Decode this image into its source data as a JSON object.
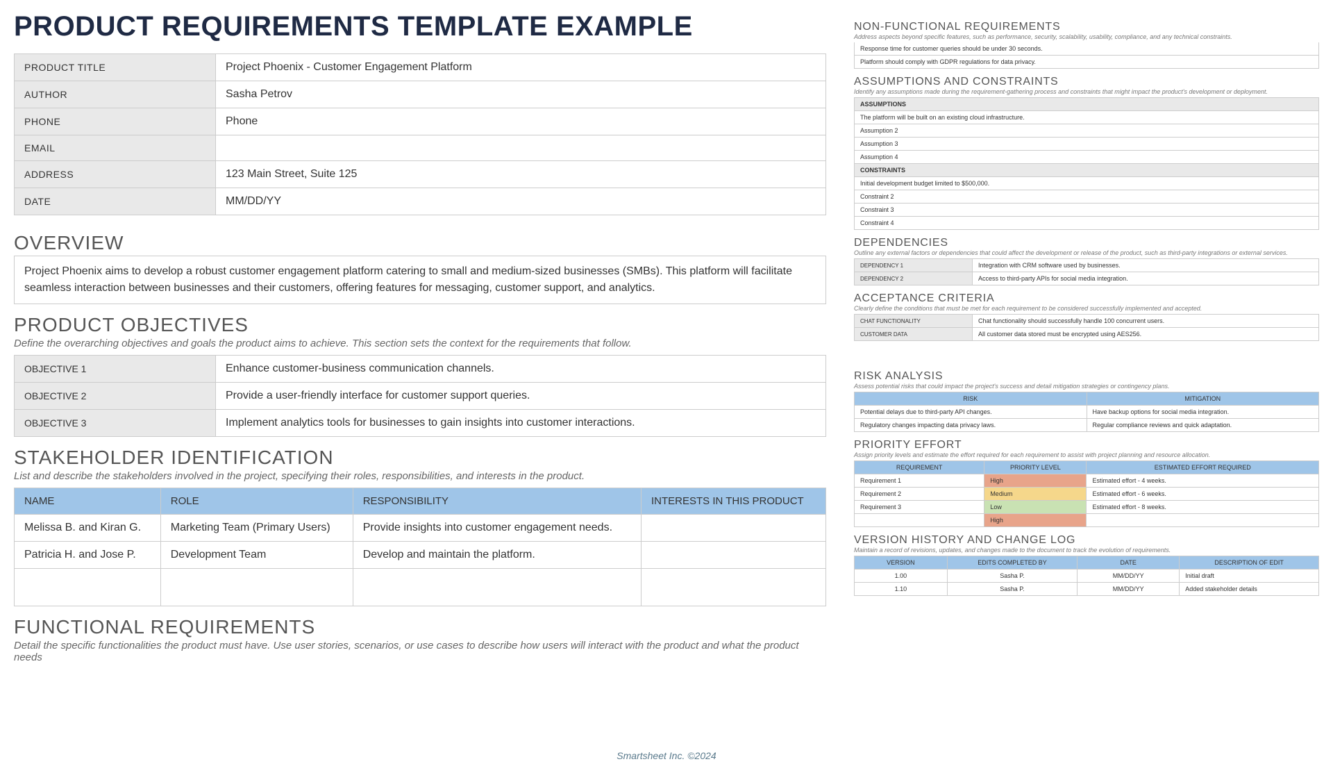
{
  "title": "PRODUCT REQUIREMENTS TEMPLATE EXAMPLE",
  "info": {
    "product_title_label": "PRODUCT TITLE",
    "product_title": "Project Phoenix - Customer Engagement Platform",
    "author_label": "AUTHOR",
    "author": "Sasha Petrov",
    "phone_label": "PHONE",
    "phone": "Phone",
    "email_label": "EMAIL",
    "email": "",
    "address_label": "ADDRESS",
    "address": "123 Main Street, Suite 125",
    "date_label": "DATE",
    "date": "MM/DD/YY"
  },
  "overview": {
    "heading": "OVERVIEW",
    "text": "Project Phoenix aims to develop a robust customer engagement platform catering to small and medium-sized businesses (SMBs). This platform will facilitate seamless interaction between businesses and their customers, offering features for messaging, customer support, and analytics."
  },
  "objectives": {
    "heading": "PRODUCT OBJECTIVES",
    "desc": "Define the overarching objectives and goals the product aims to achieve. This section sets the context for the requirements that follow.",
    "items": [
      {
        "label": "OBJECTIVE 1",
        "text": "Enhance customer-business communication channels."
      },
      {
        "label": "OBJECTIVE 2",
        "text": "Provide a user-friendly interface for customer support queries."
      },
      {
        "label": "OBJECTIVE 3",
        "text": "Implement analytics tools for businesses to gain insights into customer interactions."
      }
    ]
  },
  "stakeholders": {
    "heading": "STAKEHOLDER IDENTIFICATION",
    "desc": "List and describe the stakeholders involved in the project, specifying their roles, responsibilities, and interests in the product.",
    "headers": [
      "NAME",
      "ROLE",
      "RESPONSIBILITY",
      "INTERESTS IN THIS PRODUCT"
    ],
    "rows": [
      {
        "name": "Melissa B. and Kiran G.",
        "role": "Marketing Team (Primary Users)",
        "resp": "Provide insights into customer engagement needs.",
        "interests": ""
      },
      {
        "name": "Patricia H. and Jose P.",
        "role": "Development Team",
        "resp": "Develop and maintain the platform.",
        "interests": ""
      },
      {
        "name": "",
        "role": "",
        "resp": "",
        "interests": ""
      }
    ]
  },
  "functional": {
    "heading": "FUNCTIONAL REQUIREMENTS",
    "desc": "Detail the specific functionalities the product must have. Use user stories, scenarios, or use cases to describe how users will interact with the product and what the product needs"
  },
  "nonfunctional": {
    "heading": "NON-FUNCTIONAL REQUIREMENTS",
    "desc": "Address aspects beyond specific features, such as performance, security, scalability, usability, compliance, and any technical constraints.",
    "items": [
      "Response time for customer queries should be under 30 seconds.",
      "Platform should comply with GDPR regulations for data privacy."
    ]
  },
  "assumptions": {
    "heading": "ASSUMPTIONS AND CONSTRAINTS",
    "desc": "Identify any assumptions made during the requirement-gathering process and constraints that might impact the product's development or deployment.",
    "assumptions_label": "ASSUMPTIONS",
    "assumptions": [
      "The platform will be built on an existing cloud infrastructure.",
      "Assumption 2",
      "Assumption 3",
      "Assumption 4"
    ],
    "constraints_label": "CONSTRAINTS",
    "constraints": [
      "Initial development budget limited to $500,000.",
      "Constraint 2",
      "Constraint 3",
      "Constraint 4"
    ]
  },
  "dependencies": {
    "heading": "DEPENDENCIES",
    "desc": "Outline any external factors or dependencies that could affect the development or release of the product, such as third-party integrations or external services.",
    "items": [
      {
        "label": "DEPENDENCY 1",
        "text": "Integration with CRM software used by businesses."
      },
      {
        "label": "DEPENDENCY 2",
        "text": "Access to third-party APIs for social media integration."
      }
    ]
  },
  "acceptance": {
    "heading": "ACCEPTANCE CRITERIA",
    "desc": "Clearly define the conditions that must be met for each requirement to be considered successfully implemented and accepted.",
    "items": [
      {
        "label": "CHAT FUNCTIONALITY",
        "text": "Chat functionality should successfully handle 100 concurrent users."
      },
      {
        "label": "CUSTOMER DATA",
        "text": "All customer data stored must be encrypted using AES256."
      }
    ]
  },
  "risk": {
    "heading": "RISK ANALYSIS",
    "desc": "Assess potential risks that could impact the project's success and detail mitigation strategies or contingency plans.",
    "headers": [
      "RISK",
      "MITIGATION"
    ],
    "rows": [
      {
        "risk": "Potential delays due to third-party API changes.",
        "mitigation": "Have backup options for social media integration."
      },
      {
        "risk": "Regulatory changes impacting data privacy laws.",
        "mitigation": "Regular compliance reviews and quick adaptation."
      }
    ]
  },
  "priority": {
    "heading": "PRIORITY EFFORT",
    "desc": "Assign priority levels and estimate the effort required for each requirement to assist with project planning and resource allocation.",
    "headers": [
      "REQUIREMENT",
      "PRIORITY LEVEL",
      "ESTIMATED EFFORT REQUIRED"
    ],
    "rows": [
      {
        "req": "Requirement 1",
        "level": "High",
        "effort": "Estimated effort - 4 weeks."
      },
      {
        "req": "Requirement 2",
        "level": "Medium",
        "effort": "Estimated effort - 6 weeks."
      },
      {
        "req": "Requirement 3",
        "level": "Low",
        "effort": "Estimated effort - 8 weeks."
      },
      {
        "req": "",
        "level": "High",
        "effort": ""
      }
    ]
  },
  "version": {
    "heading": "VERSION HISTORY AND CHANGE LOG",
    "desc": "Maintain a record of revisions, updates, and changes made to the document to track the evolution of requirements.",
    "headers": [
      "VERSION",
      "EDITS COMPLETED BY",
      "DATE",
      "DESCRIPTION OF EDIT"
    ],
    "rows": [
      {
        "v": "1.00",
        "by": "Sasha P.",
        "date": "MM/DD/YY",
        "desc": "Initial draft"
      },
      {
        "v": "1.10",
        "by": "Sasha P.",
        "date": "MM/DD/YY",
        "desc": "Added stakeholder details"
      }
    ]
  },
  "footer": "Smartsheet Inc. ©2024"
}
